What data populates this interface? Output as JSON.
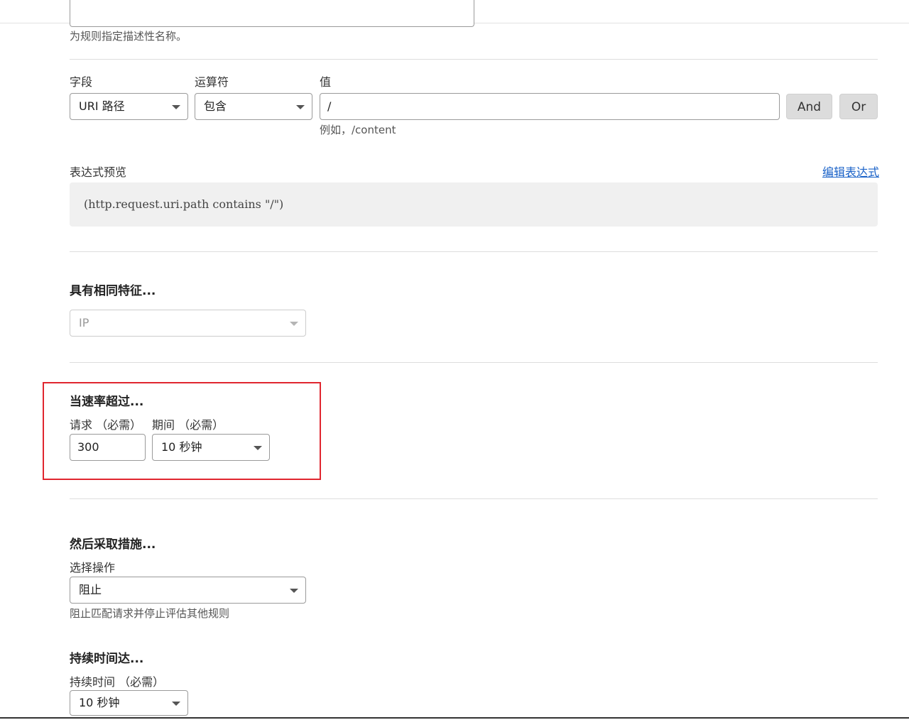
{
  "name_field": {
    "hint": "为规则指定描述性名称。"
  },
  "match": {
    "field_label": "字段",
    "operator_label": "运算符",
    "value_label": "值",
    "field_value": "URI 路径",
    "operator_value": "包含",
    "value_value": "/",
    "value_hint": "例如，/content",
    "and_label": "And",
    "or_label": "Or"
  },
  "expression": {
    "label": "表达式预览",
    "edit_link": "编辑表达式",
    "preview": "(http.request.uri.path contains \"/\")"
  },
  "characteristics": {
    "heading": "具有相同特征...",
    "value": "IP"
  },
  "rate": {
    "heading": "当速率超过...",
    "requests_label": "请求 （必需）",
    "period_label": "期间 （必需）",
    "requests_value": "300",
    "period_value": "10 秒钟"
  },
  "action": {
    "heading": "然后采取措施...",
    "label": "选择操作",
    "value": "阻止",
    "hint": "阻止匹配请求并停止评估其他规则"
  },
  "duration": {
    "heading": "持续时间达...",
    "label": "持续时间 （必需）",
    "value": "10 秒钟"
  },
  "colors": {
    "highlight_border": "#e0262f",
    "link": "#1a62c8",
    "button_bg": "#dcdcdc"
  }
}
